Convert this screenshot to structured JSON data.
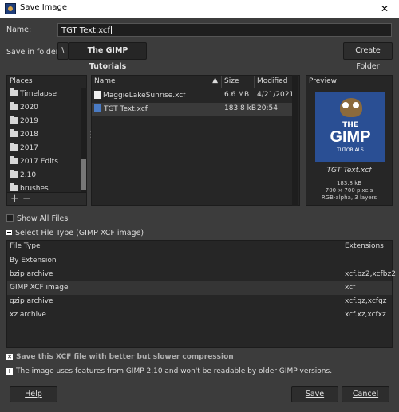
{
  "window": {
    "title": "Save Image",
    "close_glyph": "✕"
  },
  "name_field": {
    "label": "Name:",
    "value": "TGT Text.xcf"
  },
  "folder": {
    "label": "Save in folder:",
    "toggle_glyph": "\\",
    "current": "The GIMP Tutorials",
    "create_button": "Create Folder"
  },
  "places": {
    "header": "Places",
    "items": [
      "Timelapse",
      "2020",
      "2019",
      "2018",
      "2017",
      "2017 Edits",
      "2.10",
      "brushes"
    ],
    "add_glyph": "+",
    "remove_glyph": "−"
  },
  "files": {
    "columns": {
      "name": "Name",
      "size": "Size",
      "modified": "Modified"
    },
    "sort_glyph": "▲",
    "rows": [
      {
        "name": "MaggieLakeSunrise.xcf",
        "size": "6.6 MB",
        "modified": "4/21/2021",
        "icon": "document-icon"
      },
      {
        "name": "TGT Text.xcf",
        "size": "183.8 kB",
        "modified": "20:54",
        "icon": "xcf-file-icon"
      }
    ],
    "selected_index": 1
  },
  "preview": {
    "header": "Preview",
    "thumb_line1": "THE",
    "thumb_line2": "GIMP",
    "thumb_line3": "TUTORIALS",
    "filename": "TGT Text.xcf",
    "info": [
      "183.8 kB",
      "700 × 700 pixels",
      "RGB-alpha, 3 layers"
    ]
  },
  "show_all_files": {
    "label": "Show All Files",
    "checked": false
  },
  "select_file_type": {
    "label": "Select File Type (GIMP XCF image)"
  },
  "file_types": {
    "columns": {
      "type": "File Type",
      "ext": "Extensions"
    },
    "rows": [
      {
        "type": "By Extension",
        "ext": ""
      },
      {
        "type": "bzip archive",
        "ext": "xcf.bz2,xcfbz2"
      },
      {
        "type": "GIMP XCF image",
        "ext": "xcf"
      },
      {
        "type": "gzip archive",
        "ext": "xcf.gz,xcfgz"
      },
      {
        "type": "xz archive",
        "ext": "xcf.xz,xcfxz"
      }
    ],
    "selected_index": 2
  },
  "options": {
    "compression": "Save this XCF file with better but slower compression",
    "compat_note": "The image uses features from GIMP 2.10 and won't be readable by older GIMP versions."
  },
  "buttons": {
    "help": "Help",
    "save": "Save",
    "cancel": "Cancel"
  },
  "colors": {
    "background": "#3c3c3c",
    "panel": "#262626",
    "thumb_blue": "#2a4f94"
  }
}
